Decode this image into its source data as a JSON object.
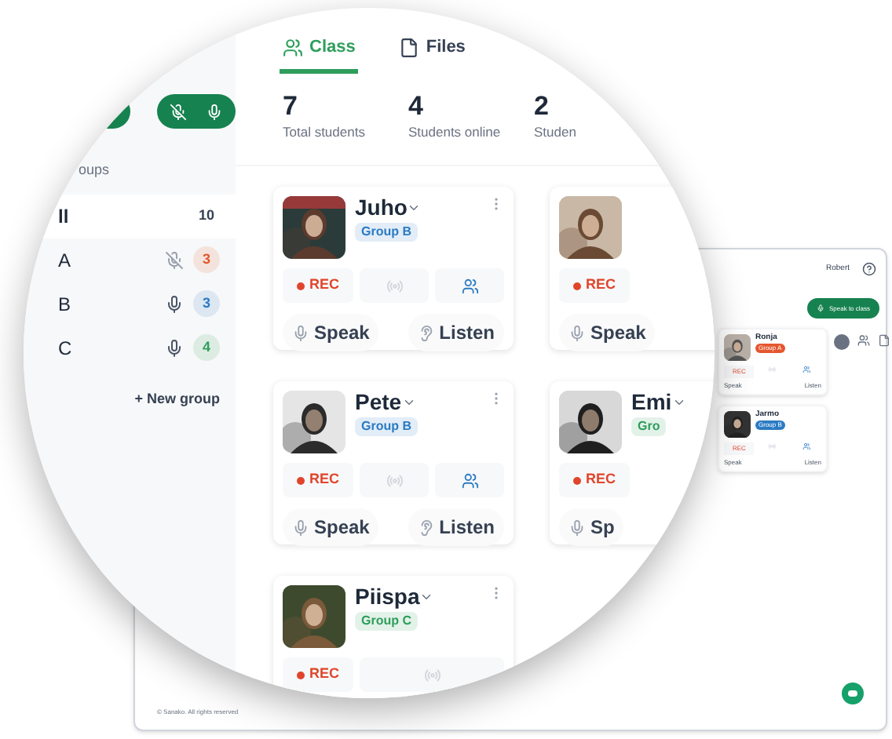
{
  "background_window": {
    "user_menu": "Robert",
    "speak_button": "Speak to class",
    "students": [
      {
        "name": "Ronja",
        "group": "Group A",
        "color": "#e4572e",
        "rec": "REC",
        "speak": "Speak",
        "listen": "Listen"
      },
      {
        "name": "Jarmo",
        "group": "Group B",
        "color": "#2b7bc4",
        "rec": "REC",
        "speak": "Speak",
        "listen": "Listen"
      }
    ],
    "footer": "© Sanako. All rights reserved"
  },
  "magnifier": {
    "mic_toggle": {
      "on": true
    },
    "groups_title": "oups",
    "groups": [
      {
        "name": "ll",
        "count": "10",
        "selected": true
      },
      {
        "name": "A",
        "count": "3",
        "selected": false,
        "muted": true,
        "color": "#e4572e"
      },
      {
        "name": "B",
        "count": "3",
        "selected": false,
        "muted": false,
        "color": "#2b7bc4"
      },
      {
        "name": "C",
        "count": "4",
        "selected": false,
        "muted": false,
        "color": "#2e9e5b"
      }
    ],
    "new_group": "+ New group",
    "tabs": [
      {
        "label": "Class",
        "selected": true
      },
      {
        "label": "Files",
        "selected": false
      }
    ],
    "stats": [
      {
        "value": "7",
        "label": "Total students"
      },
      {
        "value": "4",
        "label": "Students online"
      },
      {
        "value": "2",
        "label": "Studen"
      }
    ],
    "students": [
      {
        "kind": "full",
        "name": "Juho",
        "group": "Group B",
        "color": "#2b7bc4",
        "rec": "REC",
        "speak": "Speak",
        "listen": "Listen"
      },
      {
        "kind": "edge",
        "rec": "REC",
        "speak": "Speak"
      },
      {
        "kind": "full",
        "name": "Pete",
        "group": "Group B",
        "color": "#2b7bc4",
        "rec": "REC",
        "speak": "Speak",
        "listen": "Listen"
      },
      {
        "kind": "edge",
        "name": "Emi",
        "group": "Gro",
        "color": "#2e9e5b",
        "rec": "REC",
        "speak": "Sp"
      },
      {
        "kind": "bottom",
        "name": "Piispa",
        "group": "Group C",
        "color": "#2e9e5b",
        "rec": "REC"
      }
    ]
  }
}
